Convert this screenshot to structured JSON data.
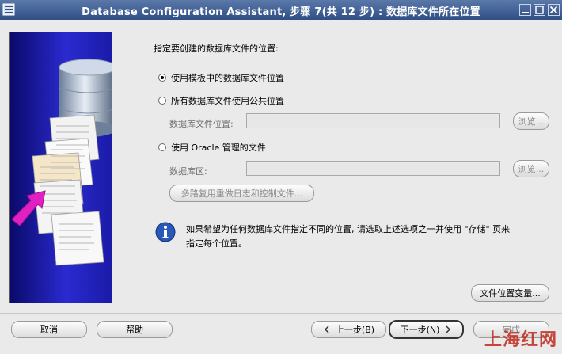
{
  "window": {
    "title": "Database Configuration Assistant, 步骤 7(共 12 步) : 数据库文件所在位置"
  },
  "main": {
    "prompt": "指定要创建的数据库文件的位置:",
    "options": [
      {
        "label": "使用模板中的数据库文件位置",
        "checked": true
      },
      {
        "label": "所有数据库文件使用公共位置",
        "checked": false
      },
      {
        "label": "使用 Oracle 管理的文件",
        "checked": false
      }
    ],
    "common_location": {
      "label": "数据库文件位置:",
      "value": "",
      "browse_label": "浏览..."
    },
    "oracle_managed": {
      "label": "数据库区:",
      "value": "",
      "browse_label": "浏览...",
      "multiplex_label": "多路复用重做日志和控制文件..."
    },
    "info_line1": "如果希望为任何数据库文件指定不同的位置, 请选取上述选项之一并使用 \"存储\" 页来",
    "info_line2": "指定每个位置。",
    "file_location_vars_label": "文件位置变量..."
  },
  "footer": {
    "cancel_label": "取消",
    "help_label": "帮助",
    "back_label": "上一步(B)",
    "next_label": "下一步(N)",
    "finish_label": "完成"
  },
  "watermark": "上海红网",
  "colors": {
    "titlebar": "#2f4f86",
    "sidepanel": "#1b1ba8",
    "accent_arrow": "#e020c0"
  }
}
